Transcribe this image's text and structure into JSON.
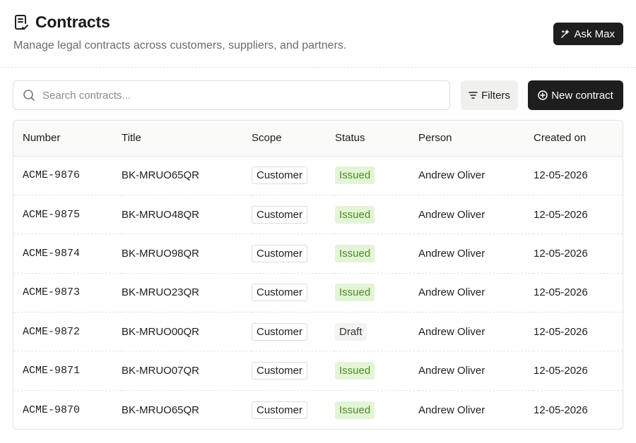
{
  "header": {
    "title": "Contracts",
    "subtitle": "Manage legal contracts across customers, suppliers, and partners.",
    "ask_label": "Ask Max"
  },
  "toolbar": {
    "search_placeholder": "Search contracts...",
    "filters_label": "Filters",
    "new_label": "New contract"
  },
  "table": {
    "columns": [
      "Number",
      "Title",
      "Scope",
      "Status",
      "Person",
      "Created on"
    ],
    "rows": [
      {
        "number": "ACME-9876",
        "title": "BK-MRUO65QR",
        "scope": "Customer",
        "status": "Issued",
        "person": "Andrew Oliver",
        "created": "12-05-2026"
      },
      {
        "number": "ACME-9875",
        "title": "BK-MRUO48QR",
        "scope": "Customer",
        "status": "Issued",
        "person": "Andrew Oliver",
        "created": "12-05-2026"
      },
      {
        "number": "ACME-9874",
        "title": "BK-MRUO98QR",
        "scope": "Customer",
        "status": "Issued",
        "person": "Andrew Oliver",
        "created": "12-05-2026"
      },
      {
        "number": "ACME-9873",
        "title": "BK-MRUO23QR",
        "scope": "Customer",
        "status": "Issued",
        "person": "Andrew Oliver",
        "created": "12-05-2026"
      },
      {
        "number": "ACME-9872",
        "title": "BK-MRUO00QR",
        "scope": "Customer",
        "status": "Draft",
        "person": "Andrew Oliver",
        "created": "12-05-2026"
      },
      {
        "number": "ACME-9871",
        "title": "BK-MRUO07QR",
        "scope": "Customer",
        "status": "Issued",
        "person": "Andrew Oliver",
        "created": "12-05-2026"
      },
      {
        "number": "ACME-9870",
        "title": "BK-MRUO65QR",
        "scope": "Customer",
        "status": "Issued",
        "person": "Andrew Oliver",
        "created": "12-05-2026"
      }
    ]
  },
  "icons": {
    "title": "contract-document-icon",
    "ask": "sparkle-icon",
    "search": "search-icon",
    "filters": "filter-lines-icon",
    "new": "plus-circle-icon"
  },
  "colors": {
    "primary_button": "#1e1e1e",
    "issued_bg": "#e3f5d6",
    "issued_text": "#4e8a26",
    "draft_bg": "#f4f4f2"
  }
}
